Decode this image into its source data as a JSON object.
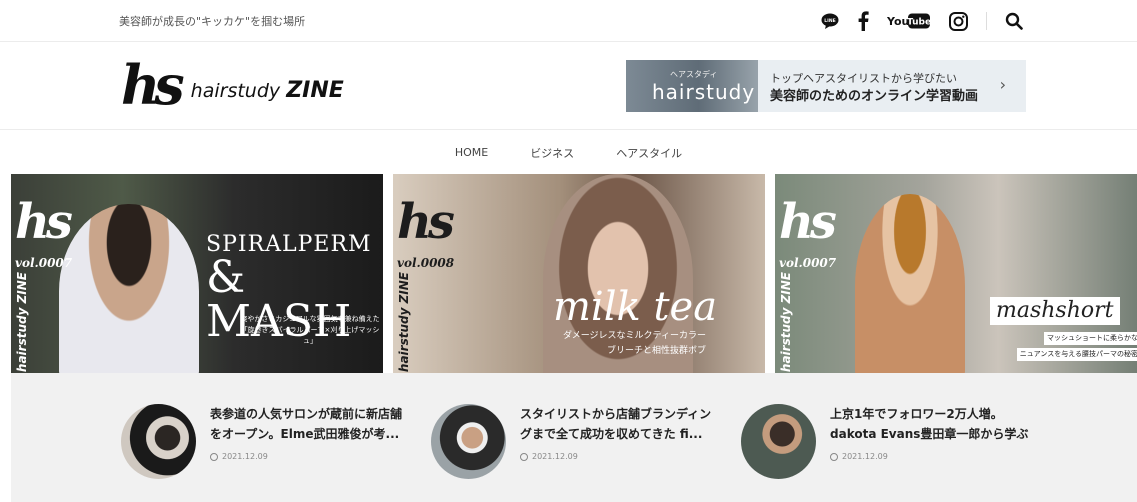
{
  "topbar": {
    "tagline": "美容師が成長の\"キッカケ\"を掴む場所",
    "social": [
      "line-icon",
      "facebook-icon",
      "youtube-icon",
      "instagram-icon",
      "search-icon"
    ],
    "line_label": "LINE",
    "youtube_you": "You",
    "youtube_tube": "Tube"
  },
  "header": {
    "logo_mark": "hs",
    "logo_text_1": "hairstudy",
    "logo_text_2": "ZINE",
    "banner": {
      "img_small": "ヘアスタディ",
      "img_big": "hairstudy",
      "line1": "トップヘアスタイリストから学びたい",
      "line2": "美容師のためのオンライン学習動画",
      "arrow": "›"
    }
  },
  "nav": {
    "items": [
      "HOME",
      "ビジネス",
      "ヘアスタイル"
    ]
  },
  "slides": [
    {
      "mark": "hs",
      "vol": "vol.0007",
      "zine": "hairstudy ZINE",
      "title_a": "SPIRALPERM",
      "title_b": "& MASH",
      "caption_1": "爽やかさとカジュアルな雰囲気を兼ね備えた",
      "caption_2": "「旋巻きスパイラルパーマ×刈り上げマッシュ」"
    },
    {
      "mark": "hs",
      "vol": "vol.0008",
      "zine": "hairstudy ZINE",
      "title": "milk tea",
      "caption_1": "ダメージレスなミルクティーカラー",
      "caption_2": "ブリーチと相性抜群ボブ"
    },
    {
      "mark": "hs",
      "vol": "vol.0007",
      "zine": "hairstudy ZINE",
      "title": "mashshort",
      "caption_1": "マッシュショートに柔らかな",
      "caption_2": "ニュアンスを与える腰技パーマの秘密"
    }
  ],
  "articles": [
    {
      "title": "表参道の人気サロンが蔵前に新店舗をオープン。Elme武田雅俊が考...",
      "date": "2021.12.09"
    },
    {
      "title": "スタイリストから店舗ブランディングまで全て成功を収めてきた fi...",
      "date": "2021.12.09"
    },
    {
      "title": "上京1年でフォロワー2万人増。dakota Evans豊田章一郎から学ぶ",
      "date": "2021.12.09"
    }
  ],
  "colors": {
    "accent": "#111111",
    "articles_bg": "#f1f1f1",
    "banner_bg": "#e9eef2"
  }
}
